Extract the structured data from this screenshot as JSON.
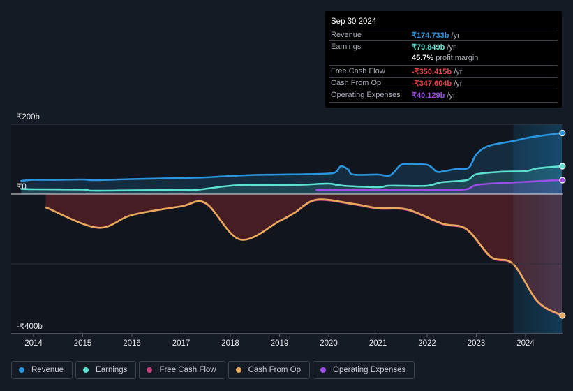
{
  "tooltip": {
    "date": "Sep 30 2024",
    "rows": [
      {
        "label": "Revenue",
        "value": "₹174.733b",
        "unit": " /yr",
        "color": "#2b96e0"
      },
      {
        "label": "Earnings",
        "value": "₹79.849b",
        "unit": " /yr",
        "color": "#5ce0cf"
      },
      {
        "label": "",
        "value": "45.7%",
        "unit": " profit margin",
        "color": "#ffffff"
      },
      {
        "label": "Free Cash Flow",
        "value": "-₹350.415b",
        "unit": " /yr",
        "color": "#e5444a"
      },
      {
        "label": "Cash From Op",
        "value": "-₹347.604b",
        "unit": " /yr",
        "color": "#e5444a"
      },
      {
        "label": "Operating Expenses",
        "value": "₹40.129b",
        "unit": " /yr",
        "color": "#9d4ee8"
      }
    ]
  },
  "legend": [
    {
      "label": "Revenue",
      "color": "#2b96e0"
    },
    {
      "label": "Earnings",
      "color": "#5ce0cf"
    },
    {
      "label": "Free Cash Flow",
      "color": "#c4427d"
    },
    {
      "label": "Cash From Op",
      "color": "#e8a95a"
    },
    {
      "label": "Operating Expenses",
      "color": "#9d4ee8"
    }
  ],
  "chart_data": {
    "type": "line",
    "title": "",
    "xlabel": "",
    "ylabel": "",
    "currency": "₹",
    "unit": "b",
    "ylim": [
      -400,
      200
    ],
    "xlim": [
      2013.75,
      2024.75
    ],
    "yticks": [
      {
        "value": 200,
        "label": "₹200b"
      },
      {
        "value": 0,
        "label": "₹0"
      },
      {
        "value": -400,
        "label": "-₹400b"
      }
    ],
    "xticks": [
      "2014",
      "2015",
      "2016",
      "2017",
      "2018",
      "2019",
      "2020",
      "2021",
      "2022",
      "2023",
      "2024"
    ],
    "highlight_region": [
      2023.75,
      2024.75
    ],
    "grid": true,
    "legend_position": "bottom",
    "series": [
      {
        "name": "Revenue",
        "color": "#2b96e0",
        "fill": true,
        "x": [
          2013.75,
          2014.0,
          2014.5,
          2015.0,
          2015.25,
          2016.0,
          2017.0,
          2017.5,
          2018.0,
          2018.5,
          2019.0,
          2019.5,
          2020.0,
          2020.15,
          2020.25,
          2020.4,
          2020.5,
          2021.0,
          2021.25,
          2021.45,
          2021.6,
          2022.0,
          2022.2,
          2022.35,
          2022.6,
          2022.85,
          2023.0,
          2023.25,
          2023.75,
          2024.0,
          2024.25,
          2024.75
        ],
        "values": [
          38,
          41,
          41,
          42,
          40,
          43,
          46,
          48,
          52,
          55,
          56,
          57,
          59,
          64,
          80,
          70,
          56,
          56,
          54,
          82,
          86,
          84,
          64,
          66,
          72,
          76,
          114,
          138,
          152,
          160,
          166,
          175
        ]
      },
      {
        "name": "Earnings",
        "color": "#5ce0cf",
        "fill": true,
        "x": [
          2013.75,
          2014.0,
          2015.0,
          2015.2,
          2016.0,
          2017.0,
          2017.3,
          2018.0,
          2018.5,
          2019.0,
          2019.5,
          2020.0,
          2020.3,
          2021.0,
          2021.2,
          2021.5,
          2022.0,
          2022.3,
          2022.8,
          2023.0,
          2023.5,
          2024.0,
          2024.25,
          2024.75
        ],
        "values": [
          15,
          14,
          13,
          10,
          11,
          12,
          12,
          24,
          26,
          26,
          27,
          30,
          24,
          20,
          24,
          24,
          24,
          34,
          40,
          57,
          64,
          66,
          74,
          80
        ]
      },
      {
        "name": "Operating Expenses",
        "color": "#9d4ee8",
        "fill": true,
        "x": [
          2019.75,
          2020.0,
          2021.0,
          2022.0,
          2022.75,
          2023.0,
          2023.5,
          2024.0,
          2024.5,
          2024.75
        ],
        "values": [
          12,
          12,
          12,
          12,
          13,
          26,
          32,
          35,
          39,
          40
        ]
      },
      {
        "name": "Free Cash Flow",
        "color": "#c4427d",
        "fill": true,
        "x": [
          2014.25,
          2015.3,
          2016.0,
          2017.0,
          2017.5,
          2018.2,
          2019.0,
          2019.3,
          2019.75,
          2020.5,
          2021.0,
          2021.6,
          2022.3,
          2022.8,
          2023.3,
          2023.75,
          2024.25,
          2024.75
        ],
        "values": [
          -38,
          -97,
          -60,
          -36,
          -28,
          -130,
          -78,
          -55,
          -18,
          -30,
          -42,
          -46,
          -86,
          -102,
          -182,
          -202,
          -310,
          -350
        ]
      },
      {
        "name": "Cash From Op",
        "color": "#e8a95a",
        "fill": false,
        "x": [
          2014.25,
          2015.3,
          2016.0,
          2017.0,
          2017.5,
          2018.2,
          2019.0,
          2019.3,
          2019.75,
          2020.5,
          2021.0,
          2021.6,
          2022.3,
          2022.8,
          2023.3,
          2023.75,
          2024.25,
          2024.75
        ],
        "values": [
          -38,
          -96,
          -60,
          -35,
          -26,
          -130,
          -77,
          -54,
          -16,
          -28,
          -40,
          -44,
          -84,
          -100,
          -180,
          -200,
          -308,
          -348
        ]
      }
    ]
  }
}
